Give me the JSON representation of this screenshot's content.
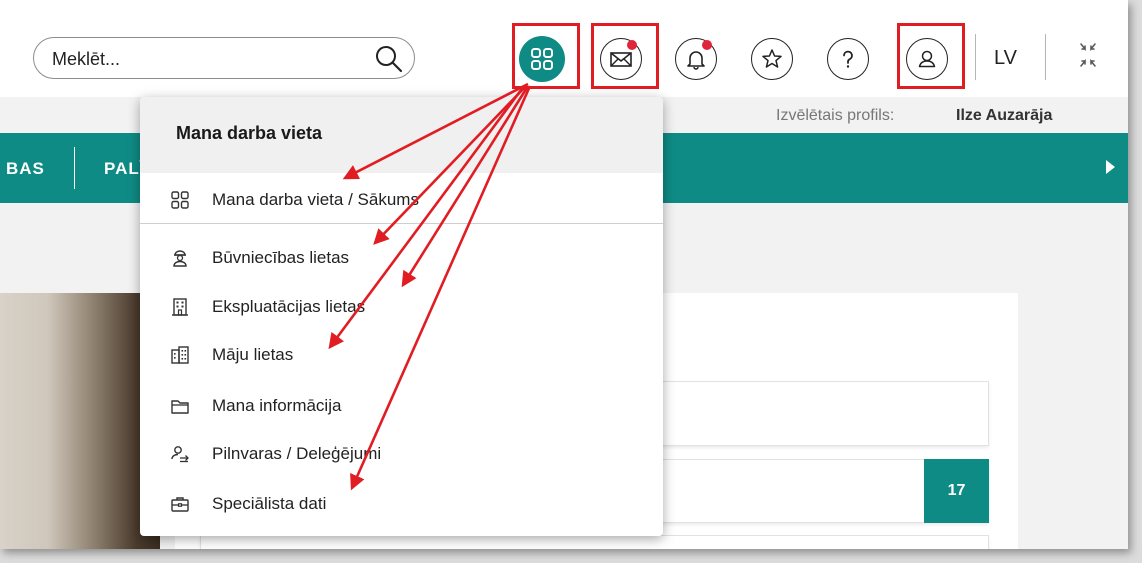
{
  "search": {
    "placeholder": "Meklēt..."
  },
  "header": {
    "language": "LV",
    "icons": [
      "apps-icon",
      "mail-icon",
      "bell-icon",
      "star-icon",
      "help-icon",
      "user-icon",
      "collapse-icon"
    ]
  },
  "profile": {
    "label": "Izvēlētais profils:",
    "name": "Ilze Auzarāja"
  },
  "navbar": {
    "items": [
      "BAS",
      "PALĪ"
    ]
  },
  "content": {
    "badge": "17"
  },
  "menu": {
    "title": "Mana darba vieta",
    "items": [
      {
        "label": "Mana darba vieta / Sākums",
        "icon": "grid-icon"
      },
      {
        "label": "Būvniecības lietas",
        "icon": "builder-icon"
      },
      {
        "label": "Ekspluatācijas lietas",
        "icon": "building-icon"
      },
      {
        "label": "Māju lietas",
        "icon": "houses-icon"
      },
      {
        "label": "Mana informācija",
        "icon": "folder-icon"
      },
      {
        "label": "Pilnvaras / Deleģējumi",
        "icon": "delegation-icon"
      },
      {
        "label": "Speciālista dati",
        "icon": "briefcase-icon"
      }
    ]
  },
  "colors": {
    "accent": "#0f8b85",
    "highlight": "#e11d24",
    "notification": "#e0243a"
  }
}
